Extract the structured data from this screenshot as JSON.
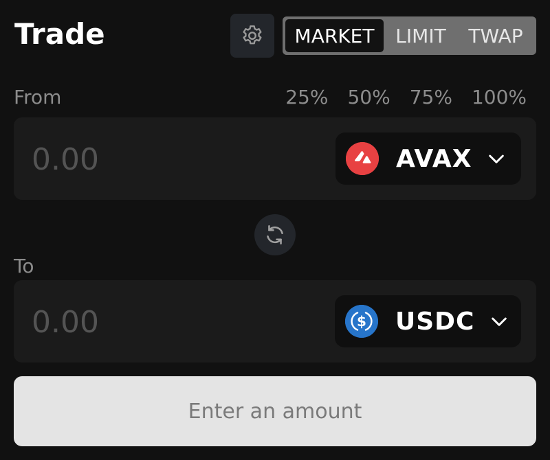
{
  "header": {
    "title": "Trade",
    "settings_icon": "gear-icon"
  },
  "order_modes": {
    "tabs": [
      "MARKET",
      "LIMIT",
      "TWAP"
    ],
    "active": "MARKET"
  },
  "from": {
    "label": "From",
    "percentages": [
      "25%",
      "50%",
      "75%",
      "100%"
    ],
    "amount_value": "",
    "amount_placeholder": "0.00",
    "token": {
      "symbol": "AVAX",
      "logo_icon": "avax-logo-icon",
      "logo_color": "#e84142"
    }
  },
  "swap_direction_icon": "swap-arrows-icon",
  "to": {
    "label": "To",
    "amount_value": "",
    "amount_placeholder": "0.00",
    "token": {
      "symbol": "USDC",
      "logo_icon": "usdc-logo-icon",
      "logo_color": "#2775ca"
    }
  },
  "submit": {
    "label": "Enter an amount"
  },
  "colors": {
    "background": "#111111",
    "input_box": "#1b1b1b",
    "token_pill": "#0f0f0f",
    "muted_text": "#8c8c8c",
    "submit_bg": "#e4e4e4"
  }
}
